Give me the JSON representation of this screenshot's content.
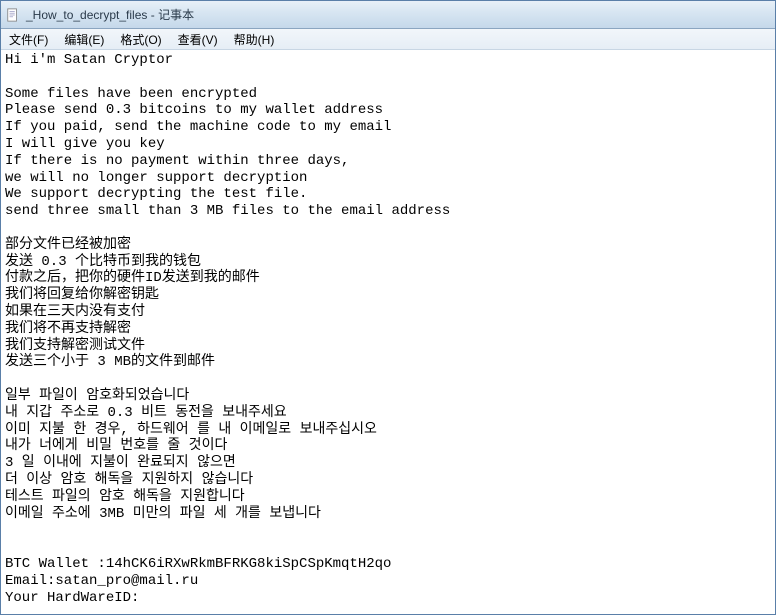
{
  "window": {
    "title": "_How_to_decrypt_files - 记事本"
  },
  "menu": {
    "file": "文件(F)",
    "edit": "编辑(E)",
    "format": "格式(O)",
    "view": "查看(V)",
    "help": "帮助(H)"
  },
  "content": {
    "line01": "Hi i'm Satan Cryptor",
    "line02": "",
    "line03": "Some files have been encrypted",
    "line04": "Please send 0.3 bitcoins to my wallet address",
    "line05": "If you paid, send the machine code to my email",
    "line06": "I will give you key",
    "line07": "If there is no payment within three days,",
    "line08": "we will no longer support decryption",
    "line09": "We support decrypting the test file.",
    "line10": "send three small than 3 MB files to the email address",
    "line11": "",
    "line12": "部分文件已经被加密",
    "line13": "发送 0.3 个比特币到我的钱包",
    "line14": "付款之后，把你的硬件ID发送到我的邮件",
    "line15": "我们将回复给你解密钥匙",
    "line16": "如果在三天内没有支付",
    "line17": "我们将不再支持解密",
    "line18": "我们支持解密测试文件",
    "line19": "发送三个小于 3 MB的文件到邮件",
    "line20": "",
    "line21": "일부 파일이 암호화되었습니다",
    "line22": "내 지갑 주소로 0.3 비트 동전을 보내주세요",
    "line23": "이미 지불 한 경우, 하드웨어 를 내 이메일로 보내주십시오",
    "line24": "내가 너에게 비밀 번호를 줄 것이다",
    "line25": "3 일 이내에 지불이 완료되지 않으면",
    "line26": "더 이상 암호 해독을 지원하지 않습니다",
    "line27": "테스트 파일의 암호 해독을 지원합니다",
    "line28": "이메일 주소에 3MB 미만의 파일 세 개를 보냅니다",
    "line29": "",
    "line30": "",
    "line31": "BTC Wallet :14hCK6iRXwRkmBFRKG8kiSpCSpKmqtH2qo",
    "line32": "Email:satan_pro@mail.ru",
    "line33": "Your HardWareID:"
  }
}
